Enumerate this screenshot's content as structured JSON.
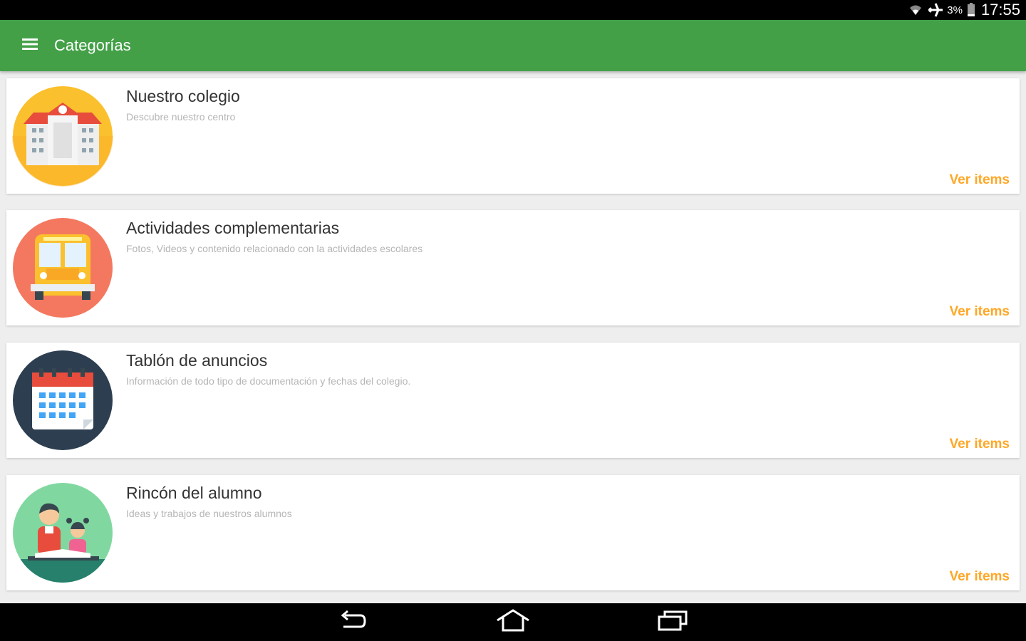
{
  "status_bar": {
    "battery_percent": "3%",
    "time": "17:55"
  },
  "app_bar": {
    "title": "Categorías",
    "menu_icon": "menu-icon"
  },
  "colors": {
    "primary": "#43a047",
    "accent": "#ffa726",
    "background": "#eeeeee"
  },
  "categories": [
    {
      "name": "Nuestro colegio",
      "description": "Descubre nuestro centro",
      "action": "Ver items",
      "icon": "school-building-icon",
      "icon_bg": "#fbc02d"
    },
    {
      "name": "Actividades complementarias",
      "description": "Fotos, Videos y contenido relacionado con la actividades escolares",
      "action": "Ver items",
      "icon": "school-bus-icon",
      "icon_bg": "#f4785f"
    },
    {
      "name": "Tablón de anuncios",
      "description": "Información de todo tipo de documentación y fechas del colegio.",
      "action": "Ver items",
      "icon": "calendar-icon",
      "icon_bg": "#2c3e50"
    },
    {
      "name": "Rincón del alumno",
      "description": "Ideas y trabajos de nuestros alumnos",
      "action": "Ver items",
      "icon": "students-icon",
      "icon_bg": "#80d8a0"
    }
  ],
  "nav_bar": {
    "icons": [
      "back-icon",
      "home-icon",
      "recents-icon"
    ]
  }
}
